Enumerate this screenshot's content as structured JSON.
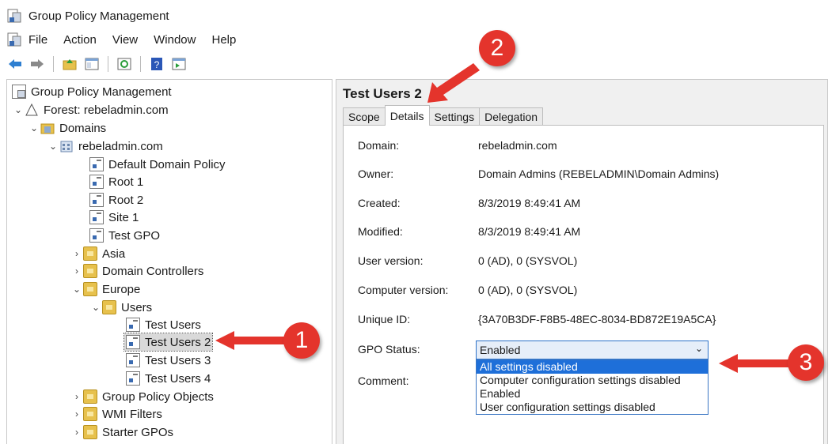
{
  "window": {
    "title": "Group Policy Management"
  },
  "menu": [
    "File",
    "Action",
    "View",
    "Window",
    "Help"
  ],
  "toolbar": [
    "back-icon",
    "forward-icon",
    "up-folder-icon",
    "show-hide-tree-icon",
    "refresh-icon",
    "help-icon",
    "properties-icon"
  ],
  "tree": [
    {
      "label": "Group Policy Management",
      "icon": "console-icon",
      "chevron": ""
    },
    {
      "label": "Forest: rebeladmin.com",
      "icon": "forest-icon",
      "chevron": "v"
    },
    {
      "label": "Domains",
      "icon": "domains-icon",
      "chevron": "v"
    },
    {
      "label": "rebeladmin.com",
      "icon": "domain-icon",
      "chevron": "v"
    },
    {
      "label": "Default Domain Policy",
      "icon": "gpo-icon",
      "chevron": ""
    },
    {
      "label": "Root 1",
      "icon": "gpo-icon",
      "chevron": ""
    },
    {
      "label": "Root 2",
      "icon": "gpo-icon",
      "chevron": ""
    },
    {
      "label": "Site 1",
      "icon": "gpo-icon",
      "chevron": ""
    },
    {
      "label": "Test GPO",
      "icon": "gpo-icon",
      "chevron": ""
    },
    {
      "label": "Asia",
      "icon": "ou-icon",
      "chevron": ">"
    },
    {
      "label": "Domain Controllers",
      "icon": "ou-icon",
      "chevron": ">"
    },
    {
      "label": "Europe",
      "icon": "ou-icon",
      "chevron": "v"
    },
    {
      "label": "Users",
      "icon": "ou-icon",
      "chevron": "v"
    },
    {
      "label": "Test Users",
      "icon": "gpo-icon",
      "chevron": ""
    },
    {
      "label": "Test Users 2",
      "icon": "gpo-icon",
      "chevron": "",
      "selected": true
    },
    {
      "label": "Test Users 3",
      "icon": "gpo-icon",
      "chevron": ""
    },
    {
      "label": "Test Users 4",
      "icon": "gpo-icon",
      "chevron": ""
    },
    {
      "label": "Group Policy Objects",
      "icon": "gpo-folder-icon",
      "chevron": ">"
    },
    {
      "label": "WMI Filters",
      "icon": "wmi-icon",
      "chevron": ">"
    },
    {
      "label": "Starter GPOs",
      "icon": "starter-icon",
      "chevron": ">"
    }
  ],
  "panel": {
    "title": "Test Users 2",
    "tabs": [
      "Scope",
      "Details",
      "Settings",
      "Delegation"
    ],
    "active_tab": "Details",
    "fields": [
      {
        "label": "Domain:",
        "value": "rebeladmin.com"
      },
      {
        "label": "Owner:",
        "value": "Domain Admins (REBELADMIN\\Domain Admins)"
      },
      {
        "label": "Created:",
        "value": "8/3/2019 8:49:41 AM"
      },
      {
        "label": "Modified:",
        "value": "8/3/2019 8:49:41 AM"
      },
      {
        "label": "User version:",
        "value": "0 (AD), 0 (SYSVOL)"
      },
      {
        "label": "Computer version:",
        "value": "0 (AD), 0 (SYSVOL)"
      },
      {
        "label": "Unique ID:",
        "value": "{3A70B3DF-F8B5-48EC-8034-BD872E19A5CA}"
      }
    ],
    "gpo_status_label": "GPO Status:",
    "gpo_status_value": "Enabled",
    "gpo_status_options": [
      "All settings disabled",
      "Computer configuration settings disabled",
      "Enabled",
      "User configuration settings disabled"
    ],
    "highlighted_option": "All settings disabled",
    "comment_label": "Comment:"
  },
  "callouts": [
    "1",
    "2",
    "3"
  ],
  "colors": {
    "callout": "#e4342c",
    "selection": "#1e6fd9"
  }
}
